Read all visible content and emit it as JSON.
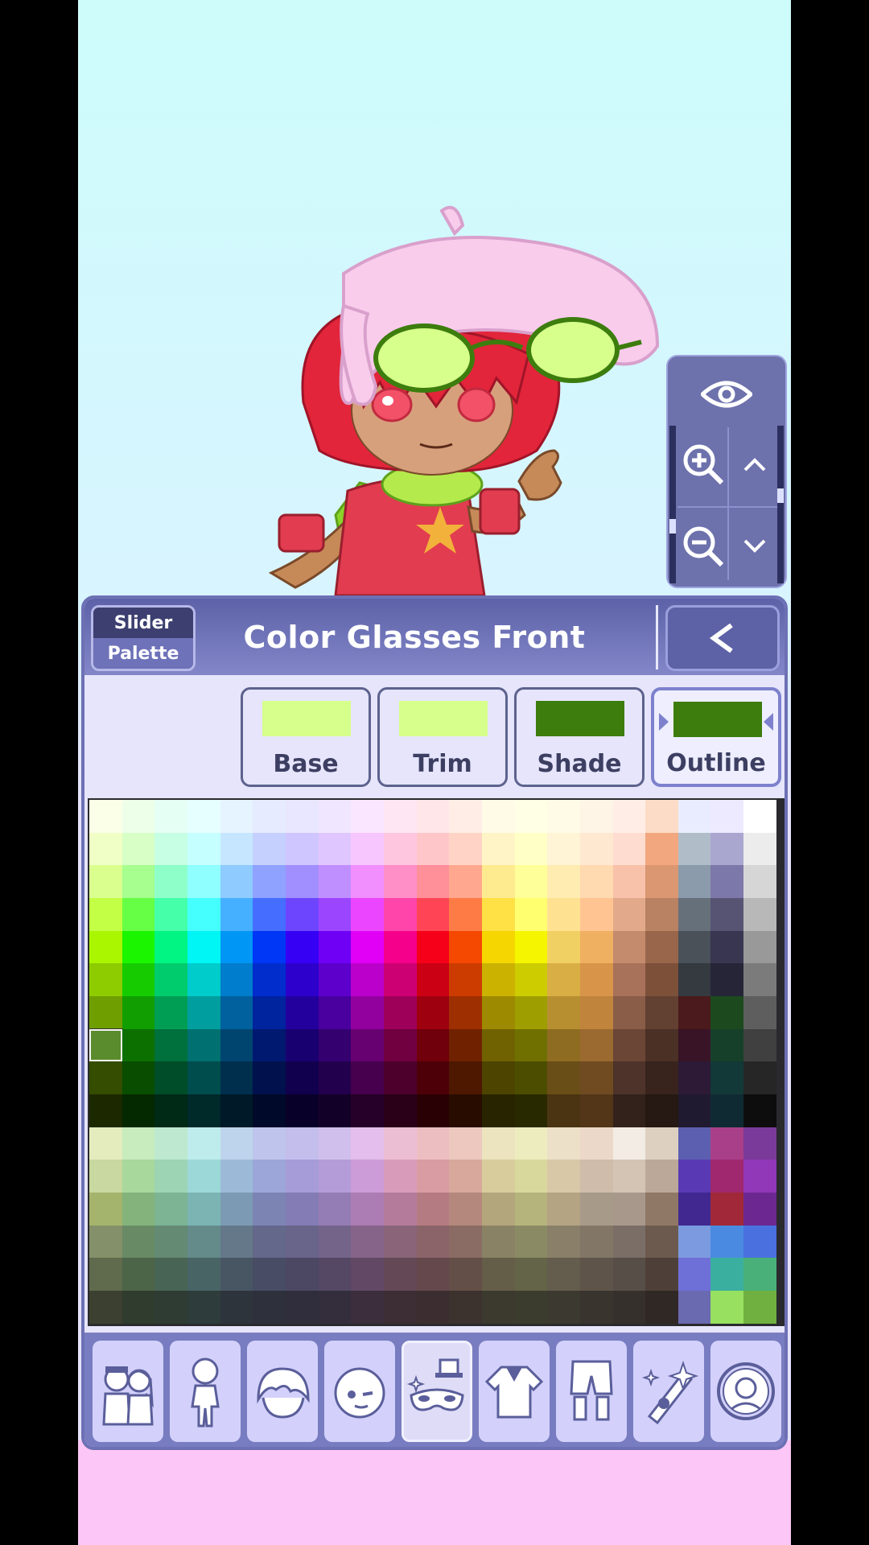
{
  "panel": {
    "title": "Color Glasses Front",
    "mode_toggle": {
      "slider_label": "Slider",
      "palette_label": "Palette",
      "selected": "Palette"
    },
    "back_label": "<"
  },
  "layers": [
    {
      "label": "Base",
      "color": "#d7ff8b"
    },
    {
      "label": "Trim",
      "color": "#d7ff8b"
    },
    {
      "label": "Shade",
      "color": "#3c7d0e"
    },
    {
      "label": "Outline",
      "color": "#3c7d0e",
      "active": true
    }
  ],
  "view_controls": {
    "icons": [
      "eye-icon",
      "zoom-in-icon",
      "chevron-up-icon",
      "zoom-out-icon",
      "chevron-down-icon"
    ]
  },
  "palette": {
    "selected_color": "#5a8b2d",
    "rows": [
      [
        "#fbffe8",
        "#edffe8",
        "#e6fff5",
        "#e6ffff",
        "#e6f4ff",
        "#e6ebff",
        "#e9e6ff",
        "#f0e6ff",
        "#fbe6ff",
        "#ffe6f3",
        "#ffe6e8",
        "#ffede6",
        "#fffbe6",
        "#ffffe6",
        "#fffbe6",
        "#fff5e6",
        "#ffede6",
        "#fcdcc6",
        "#e9ecff",
        "#ede9ff",
        "#ffffff"
      ],
      [
        "#f0ffc6",
        "#d7ffc6",
        "#c6ffe3",
        "#c6ffff",
        "#c6e6ff",
        "#c6d0ff",
        "#d0c6ff",
        "#e0c6ff",
        "#f8c6ff",
        "#ffc6e0",
        "#ffc6ca",
        "#ffd4c6",
        "#fff4c6",
        "#ffffc6",
        "#fff4d6",
        "#ffe8d0",
        "#ffdcd0",
        "#f2a77f",
        "#b0bdc9",
        "#a9a6cf",
        "#ececec"
      ],
      [
        "#dbff8f",
        "#a6ff8f",
        "#8fffca",
        "#8fffff",
        "#8fcbff",
        "#8fa2ff",
        "#a28fff",
        "#c08fff",
        "#f28fff",
        "#ff8fc6",
        "#ff8f99",
        "#ffa88f",
        "#ffeb8f",
        "#ffff99",
        "#ffecb0",
        "#ffd9b0",
        "#f8c1a9",
        "#da9772",
        "#8b9bab",
        "#7d78aa",
        "#d6d6d6"
      ],
      [
        "#c2ff45",
        "#66ff45",
        "#45ffa9",
        "#45ffff",
        "#45b0ff",
        "#456dff",
        "#6d45ff",
        "#9b45ff",
        "#ec45ff",
        "#ff45aa",
        "#ff4555",
        "#ff7b45",
        "#ffe045",
        "#ffff70",
        "#ffe192",
        "#ffc492",
        "#e2aa8b",
        "#b98262",
        "#66707b",
        "#575473",
        "#b8b8b8"
      ],
      [
        "#aaf500",
        "#1cf500",
        "#00f582",
        "#00f5f5",
        "#0096f5",
        "#0036f5",
        "#3600f5",
        "#7000f5",
        "#e100f5",
        "#f5008a",
        "#f50018",
        "#f54800",
        "#f5d600",
        "#f5f500",
        "#f0d062",
        "#f0b062",
        "#c48b6d",
        "#9a664b",
        "#4a5159",
        "#383650",
        "#999999"
      ],
      [
        "#8ecc00",
        "#16cc00",
        "#00cc6d",
        "#00cccc",
        "#007dcc",
        "#002dcc",
        "#2d00cc",
        "#5d00cc",
        "#bb00cc",
        "#cc0073",
        "#cc0014",
        "#cc3c00",
        "#ccb200",
        "#cccc00",
        "#d8ae45",
        "#d8954a",
        "#a8725a",
        "#7d503a",
        "#353a40",
        "#262538",
        "#7b7b7b"
      ],
      [
        "#6f9e00",
        "#119e00",
        "#009e54",
        "#009e9e",
        "#00619e",
        "#00239e",
        "#23009e",
        "#49009e",
        "#92009e",
        "#9e0059",
        "#9e0010",
        "#9e2f00",
        "#9e8a00",
        "#9e9e00",
        "#b88f30",
        "#c0843c",
        "#8a5d49",
        "#624032",
        "#4b1a1c",
        "#1c4a1e",
        "#5e5e5e"
      ],
      [
        "#5a8b2d",
        "#0c7000",
        "#00703c",
        "#007070",
        "#004570",
        "#001970",
        "#190070",
        "#340070",
        "#670070",
        "#700040",
        "#70000b",
        "#702100",
        "#706200",
        "#707000",
        "#8e6d22",
        "#9a6a30",
        "#6b4637",
        "#4b3026",
        "#381426",
        "#17402b",
        "#404040"
      ],
      [
        "#344d00",
        "#084d00",
        "#004d29",
        "#004d4d",
        "#002f4d",
        "#00114d",
        "#11004d",
        "#23004d",
        "#47004d",
        "#4d002c",
        "#4d0008",
        "#4d1700",
        "#4d4400",
        "#4d4d00",
        "#6a4e18",
        "#704b22",
        "#4d3329",
        "#38241c",
        "#2c1a36",
        "#133838",
        "#262626"
      ],
      [
        "#1c2900",
        "#042900",
        "#002916",
        "#002929",
        "#001929",
        "#000929",
        "#090029",
        "#130029",
        "#260029",
        "#290017",
        "#290004",
        "#290c00",
        "#292400",
        "#292900",
        "#4a3411",
        "#533517",
        "#33221b",
        "#261812",
        "#201a30",
        "#102a33",
        "#0d0d0d"
      ],
      [
        "#e4ecbe",
        "#c8ecbe",
        "#bee8d0",
        "#beecec",
        "#bed4ec",
        "#bec4ec",
        "#c4beec",
        "#d0beec",
        "#e4beec",
        "#ecbed4",
        "#ecbec2",
        "#ecc8be",
        "#ece4be",
        "#ececbe",
        "#ece0c8",
        "#ecd8c8",
        "#f2ece4",
        "#ddd0c0",
        "#5c5fb0",
        "#a93f88",
        "#7a3a9a"
      ],
      [
        "#c8d8a0",
        "#a8d89c",
        "#9cd4b4",
        "#9cd8d8",
        "#9cbad8",
        "#9ca6d8",
        "#a69cd8",
        "#b49cd8",
        "#cc9cd8",
        "#d89cba",
        "#d89ca2",
        "#d8a89c",
        "#d8cc9c",
        "#d8d89c",
        "#d8c8a8",
        "#d0bcaa",
        "#d4c4b4",
        "#bca898",
        "#5a3ab4",
        "#a0286e",
        "#9038b8"
      ],
      [
        "#a4b46c",
        "#84b47c",
        "#7cb494",
        "#7cb4b4",
        "#7c9ab4",
        "#7c84b4",
        "#847cb4",
        "#947cb4",
        "#ac7cb4",
        "#b47c9a",
        "#b47c82",
        "#b4887c",
        "#b4a67c",
        "#b4b47c",
        "#b4a484",
        "#a89a88",
        "#a8988c",
        "#907866",
        "#402890",
        "#a02838",
        "#6c2890"
      ],
      [
        "#84906a",
        "#688a64",
        "#648a74",
        "#648a8a",
        "#64788a",
        "#64688a",
        "#68648a",
        "#74648a",
        "#86648a",
        "#8a6478",
        "#8a6468",
        "#8a6c64",
        "#8a8264",
        "#8a8a64",
        "#8a806a",
        "#827666",
        "#7a6e66",
        "#6c5a4e",
        "#7c9ae0",
        "#4a8ae0",
        "#4a70e0"
      ],
      [
        "#606a4c",
        "#4c6448",
        "#486454",
        "#486464",
        "#485664",
        "#484c64",
        "#4c4864",
        "#544864",
        "#624864",
        "#644856",
        "#64484c",
        "#644e48",
        "#645e48",
        "#646448",
        "#645c4c",
        "#5e544a",
        "#584e48",
        "#4e4038",
        "#6f6fd8",
        "#3aafa0",
        "#48b078"
      ],
      [
        "#3c4030",
        "#303c2e",
        "#2e3c34",
        "#2e3c3c",
        "#2e343c",
        "#2e303c",
        "#302e3c",
        "#342e3c",
        "#3c2e3c",
        "#3c2e34",
        "#3c2e30",
        "#3c322e",
        "#3c3a2e",
        "#3c3c2e",
        "#3c3a30",
        "#3a342e",
        "#36302c",
        "#302824",
        "#6a6ab0",
        "#98e060",
        "#70b040"
      ]
    ]
  },
  "categories": [
    {
      "name": "presets-icon"
    },
    {
      "name": "body-icon"
    },
    {
      "name": "hair-icon"
    },
    {
      "name": "face-icon"
    },
    {
      "name": "accessories-icon",
      "active": true
    },
    {
      "name": "top-clothing-icon"
    },
    {
      "name": "bottom-clothing-icon"
    },
    {
      "name": "props-icon"
    },
    {
      "name": "profile-icon"
    }
  ]
}
